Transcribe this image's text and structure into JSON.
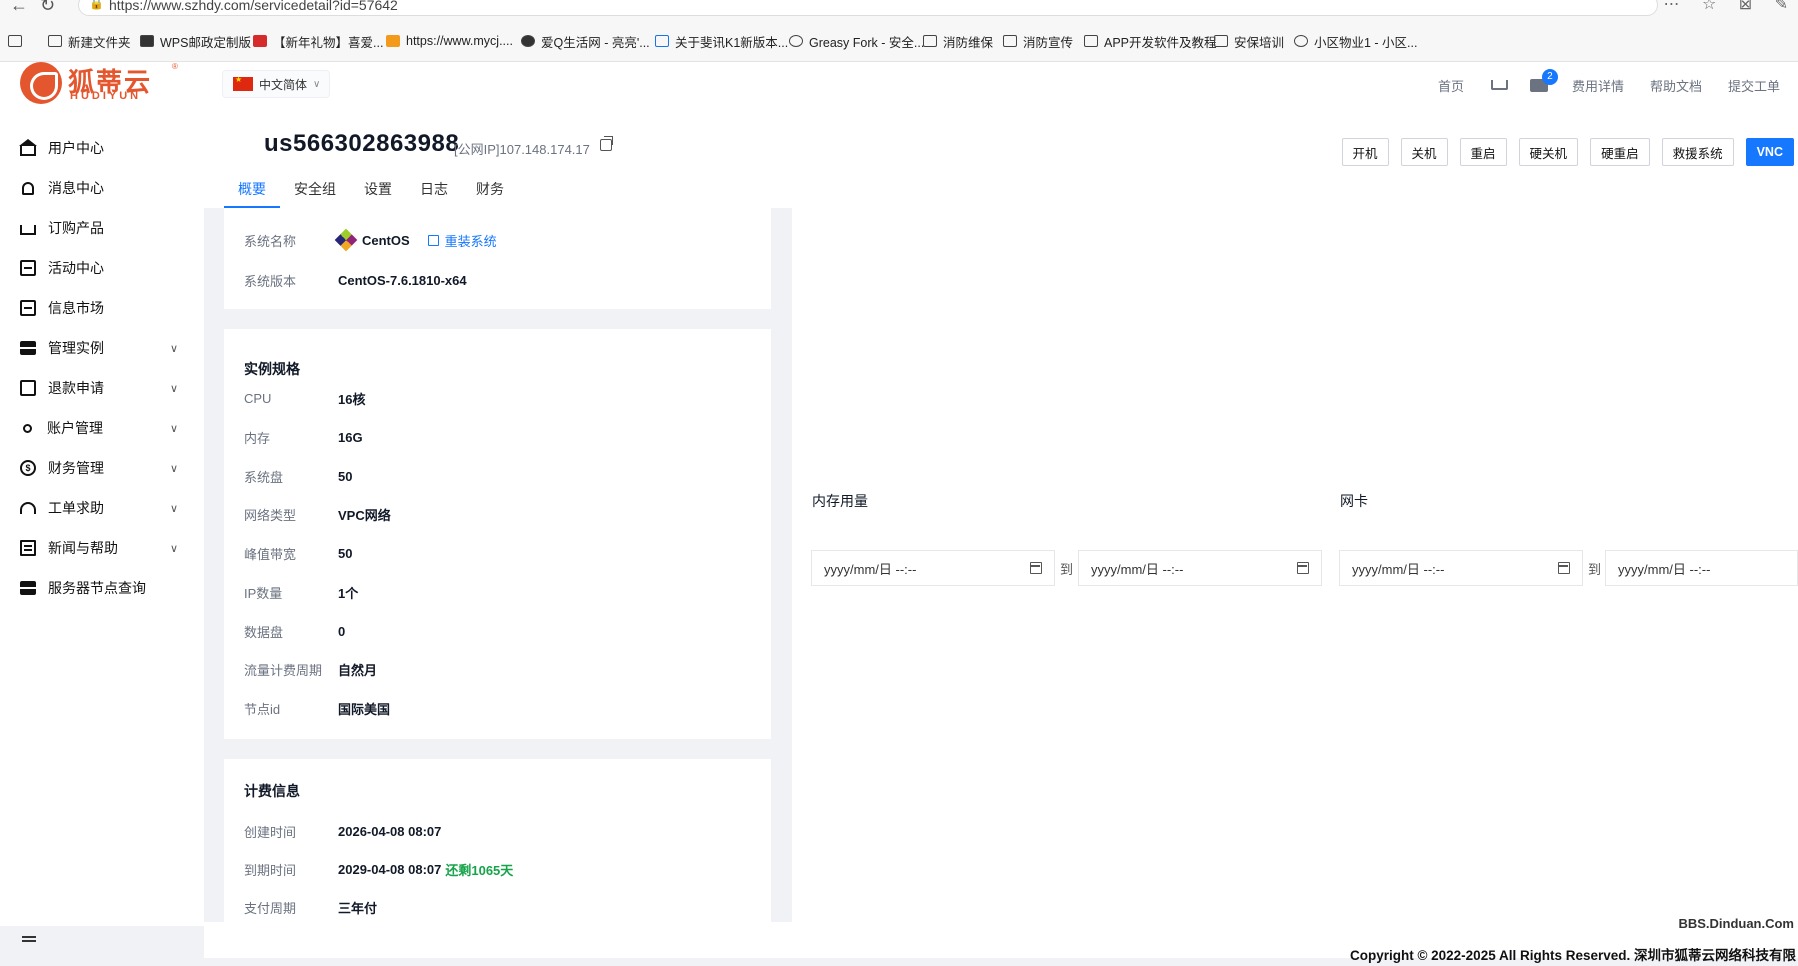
{
  "browser": {
    "url": "https://www.szhdy.com/servicedetail?id=57642",
    "bookmarks": [
      {
        "label": "新建文件夹",
        "icon": "folder-icon"
      },
      {
        "label": "WPS邮政定制版",
        "icon": "wps-icon"
      },
      {
        "label": "【新年礼物】喜爱...",
        "icon": "red-logo-icon"
      },
      {
        "label": "https://www.mycj....",
        "icon": "orange-logo-icon"
      },
      {
        "label": "爱Q生活网 - 亮亮'...",
        "icon": "aiq-icon"
      },
      {
        "label": "关于斐讯K1新版本...",
        "icon": "blue-house-icon"
      },
      {
        "label": "Greasy Fork - 安全...",
        "icon": "globe-icon"
      },
      {
        "label": "消防维保",
        "icon": "folder-icon"
      },
      {
        "label": "消防宣传",
        "icon": "folder-icon"
      },
      {
        "label": "APP开发软件及教程",
        "icon": "folder-icon"
      },
      {
        "label": "安保培训",
        "icon": "folder-icon"
      },
      {
        "label": "小区物业1 - 小区...",
        "icon": "globe-icon"
      }
    ]
  },
  "header": {
    "logo_cn": "狐蒂云",
    "logo_en": "HUDIYUN",
    "logo_tm": "®",
    "language": "中文简体",
    "links": {
      "home": "首页",
      "billing": "费用详情",
      "help": "帮助文档",
      "ticket": "提交工单"
    },
    "mail_badge": "2"
  },
  "sidebar": {
    "items": [
      {
        "label": "用户中心",
        "icon": "home-icon",
        "expandable": false
      },
      {
        "label": "消息中心",
        "icon": "bell-icon",
        "expandable": false
      },
      {
        "label": "订购产品",
        "icon": "cart-icon",
        "expandable": false
      },
      {
        "label": "活动中心",
        "icon": "store-icon",
        "expandable": false
      },
      {
        "label": "信息市场",
        "icon": "store-icon",
        "expandable": false
      },
      {
        "label": "管理实例",
        "icon": "server-icon",
        "expandable": true
      },
      {
        "label": "退款申请",
        "icon": "document-icon",
        "expandable": true
      },
      {
        "label": "账户管理",
        "icon": "user-icon",
        "expandable": true
      },
      {
        "label": "财务管理",
        "icon": "money-icon",
        "expandable": true
      },
      {
        "label": "工单求助",
        "icon": "headset-icon",
        "expandable": true
      },
      {
        "label": "新闻与帮助",
        "icon": "news-icon",
        "expandable": true
      },
      {
        "label": "服务器节点查询",
        "icon": "server-icon",
        "expandable": false
      }
    ]
  },
  "instance": {
    "id": "us566302863988",
    "public_ip_label": "[公网IP]107.148.174.17"
  },
  "actions": {
    "power_on": "开机",
    "power_off": "关机",
    "reboot": "重启",
    "hard_off": "硬关机",
    "hard_reboot": "硬重启",
    "rescue": "救援系统",
    "vnc": "VNC"
  },
  "tabs": [
    "概要",
    "安全组",
    "设置",
    "日志",
    "财务"
  ],
  "os": {
    "name_label": "系统名称",
    "name_value": "CentOS",
    "reinstall": "重装系统",
    "version_label": "系统版本",
    "version_value": "CentOS-7.6.1810-x64"
  },
  "spec": {
    "title": "实例规格",
    "rows": [
      {
        "label": "CPU",
        "value": "16核"
      },
      {
        "label": "内存",
        "value": "16G"
      },
      {
        "label": "系统盘",
        "value": "50"
      },
      {
        "label": "网络类型",
        "value": "VPC网络"
      },
      {
        "label": "峰值带宽",
        "value": "50"
      },
      {
        "label": "IP数量",
        "value": "1个"
      },
      {
        "label": "数据盘",
        "value": "0"
      },
      {
        "label": "流量计费周期",
        "value": "自然月"
      },
      {
        "label": "节点id",
        "value": "国际美国"
      }
    ]
  },
  "billing": {
    "title": "计费信息",
    "created_label": "创建时间",
    "created_value": "2026-04-08 08:07",
    "expire_label": "到期时间",
    "expire_value": "2029-04-08 08:07",
    "remaining": "还剩1065天",
    "cycle_label": "支付周期",
    "cycle_value": "三年付"
  },
  "monitor": {
    "memory_label": "内存用量",
    "nic_label": "网卡",
    "date_placeholder": "yyyy/mm/日 --:--",
    "to_label": "到"
  },
  "footer": {
    "copyright": "Copyright © 2022-2025 All Rights Reserved. 深圳市狐蒂云网络科技有限",
    "watermark": "BBS.Dinduan.Com"
  }
}
